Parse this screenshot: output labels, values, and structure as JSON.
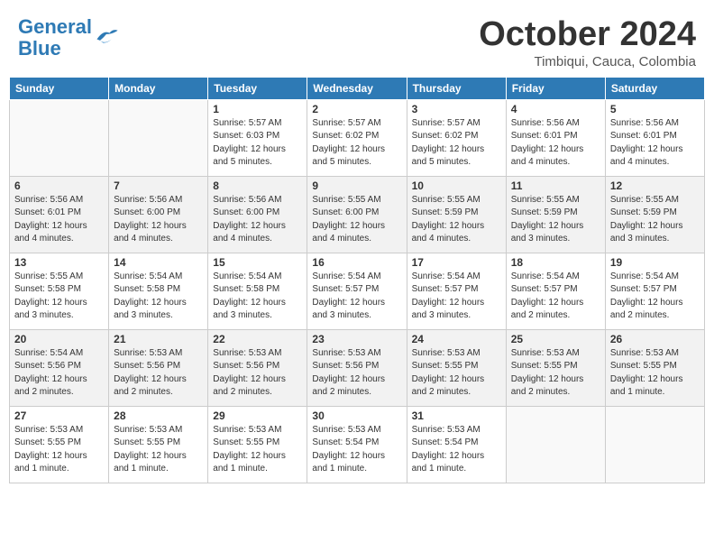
{
  "header": {
    "logo_line1": "General",
    "logo_line2": "Blue",
    "month": "October 2024",
    "location": "Timbiqui, Cauca, Colombia"
  },
  "days_of_week": [
    "Sunday",
    "Monday",
    "Tuesday",
    "Wednesday",
    "Thursday",
    "Friday",
    "Saturday"
  ],
  "weeks": [
    [
      {
        "day": "",
        "info": ""
      },
      {
        "day": "",
        "info": ""
      },
      {
        "day": "1",
        "info": "Sunrise: 5:57 AM\nSunset: 6:03 PM\nDaylight: 12 hours\nand 5 minutes."
      },
      {
        "day": "2",
        "info": "Sunrise: 5:57 AM\nSunset: 6:02 PM\nDaylight: 12 hours\nand 5 minutes."
      },
      {
        "day": "3",
        "info": "Sunrise: 5:57 AM\nSunset: 6:02 PM\nDaylight: 12 hours\nand 5 minutes."
      },
      {
        "day": "4",
        "info": "Sunrise: 5:56 AM\nSunset: 6:01 PM\nDaylight: 12 hours\nand 4 minutes."
      },
      {
        "day": "5",
        "info": "Sunrise: 5:56 AM\nSunset: 6:01 PM\nDaylight: 12 hours\nand 4 minutes."
      }
    ],
    [
      {
        "day": "6",
        "info": "Sunrise: 5:56 AM\nSunset: 6:01 PM\nDaylight: 12 hours\nand 4 minutes."
      },
      {
        "day": "7",
        "info": "Sunrise: 5:56 AM\nSunset: 6:00 PM\nDaylight: 12 hours\nand 4 minutes."
      },
      {
        "day": "8",
        "info": "Sunrise: 5:56 AM\nSunset: 6:00 PM\nDaylight: 12 hours\nand 4 minutes."
      },
      {
        "day": "9",
        "info": "Sunrise: 5:55 AM\nSunset: 6:00 PM\nDaylight: 12 hours\nand 4 minutes."
      },
      {
        "day": "10",
        "info": "Sunrise: 5:55 AM\nSunset: 5:59 PM\nDaylight: 12 hours\nand 4 minutes."
      },
      {
        "day": "11",
        "info": "Sunrise: 5:55 AM\nSunset: 5:59 PM\nDaylight: 12 hours\nand 3 minutes."
      },
      {
        "day": "12",
        "info": "Sunrise: 5:55 AM\nSunset: 5:59 PM\nDaylight: 12 hours\nand 3 minutes."
      }
    ],
    [
      {
        "day": "13",
        "info": "Sunrise: 5:55 AM\nSunset: 5:58 PM\nDaylight: 12 hours\nand 3 minutes."
      },
      {
        "day": "14",
        "info": "Sunrise: 5:54 AM\nSunset: 5:58 PM\nDaylight: 12 hours\nand 3 minutes."
      },
      {
        "day": "15",
        "info": "Sunrise: 5:54 AM\nSunset: 5:58 PM\nDaylight: 12 hours\nand 3 minutes."
      },
      {
        "day": "16",
        "info": "Sunrise: 5:54 AM\nSunset: 5:57 PM\nDaylight: 12 hours\nand 3 minutes."
      },
      {
        "day": "17",
        "info": "Sunrise: 5:54 AM\nSunset: 5:57 PM\nDaylight: 12 hours\nand 3 minutes."
      },
      {
        "day": "18",
        "info": "Sunrise: 5:54 AM\nSunset: 5:57 PM\nDaylight: 12 hours\nand 2 minutes."
      },
      {
        "day": "19",
        "info": "Sunrise: 5:54 AM\nSunset: 5:57 PM\nDaylight: 12 hours\nand 2 minutes."
      }
    ],
    [
      {
        "day": "20",
        "info": "Sunrise: 5:54 AM\nSunset: 5:56 PM\nDaylight: 12 hours\nand 2 minutes."
      },
      {
        "day": "21",
        "info": "Sunrise: 5:53 AM\nSunset: 5:56 PM\nDaylight: 12 hours\nand 2 minutes."
      },
      {
        "day": "22",
        "info": "Sunrise: 5:53 AM\nSunset: 5:56 PM\nDaylight: 12 hours\nand 2 minutes."
      },
      {
        "day": "23",
        "info": "Sunrise: 5:53 AM\nSunset: 5:56 PM\nDaylight: 12 hours\nand 2 minutes."
      },
      {
        "day": "24",
        "info": "Sunrise: 5:53 AM\nSunset: 5:55 PM\nDaylight: 12 hours\nand 2 minutes."
      },
      {
        "day": "25",
        "info": "Sunrise: 5:53 AM\nSunset: 5:55 PM\nDaylight: 12 hours\nand 2 minutes."
      },
      {
        "day": "26",
        "info": "Sunrise: 5:53 AM\nSunset: 5:55 PM\nDaylight: 12 hours\nand 1 minute."
      }
    ],
    [
      {
        "day": "27",
        "info": "Sunrise: 5:53 AM\nSunset: 5:55 PM\nDaylight: 12 hours\nand 1 minute."
      },
      {
        "day": "28",
        "info": "Sunrise: 5:53 AM\nSunset: 5:55 PM\nDaylight: 12 hours\nand 1 minute."
      },
      {
        "day": "29",
        "info": "Sunrise: 5:53 AM\nSunset: 5:55 PM\nDaylight: 12 hours\nand 1 minute."
      },
      {
        "day": "30",
        "info": "Sunrise: 5:53 AM\nSunset: 5:54 PM\nDaylight: 12 hours\nand 1 minute."
      },
      {
        "day": "31",
        "info": "Sunrise: 5:53 AM\nSunset: 5:54 PM\nDaylight: 12 hours\nand 1 minute."
      },
      {
        "day": "",
        "info": ""
      },
      {
        "day": "",
        "info": ""
      }
    ]
  ]
}
